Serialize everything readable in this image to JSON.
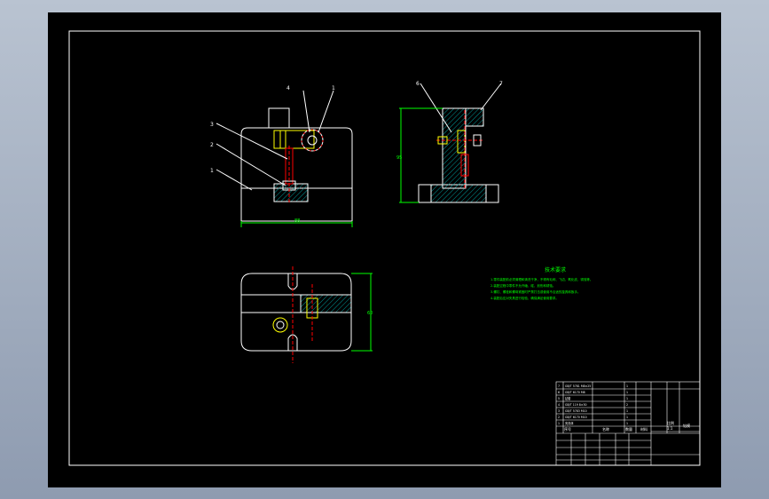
{
  "colors": {
    "background": "#000000",
    "frame": "#ffffff",
    "outline": "#ffffff",
    "dimension": "#00ff00",
    "hatch": "#009999",
    "center_line": "#ff0000",
    "bolt": "#ffff00",
    "notes": "#00ff00",
    "titleblock": "#ffffff"
  },
  "drawing": {
    "front_view": {
      "balloons": [
        "4",
        "1",
        "3",
        "2",
        "1"
      ],
      "dim_width": "88"
    },
    "side_view": {
      "balloons": [
        "6",
        "7"
      ],
      "dim_height": "95"
    },
    "top_view": {
      "dim_height": "60"
    }
  },
  "notes": {
    "title": "技术要求",
    "lines": [
      "1.零件装配前必须清理和清洗干净，不得有毛刺、飞边、氧化皮、锈蚀等。",
      "2.装配过程中零件不允许磕、碰、划伤和锈蚀。",
      "3.螺钉、螺栓和螺母紧固时严禁打击或使用不合适的旋具和扳手。",
      "4.装配后应对夹具进行检验，确保满足使用要求。"
    ]
  },
  "title_block": {
    "header": [
      "序号",
      "名称",
      "数量",
      "材料"
    ],
    "title_cells": [
      "比例",
      "1:1",
      "钻模"
    ],
    "rows": [
      [
        "7",
        "GB/T 5781 M8×25",
        "1"
      ],
      [
        "6",
        "GB/T 6170 M8",
        "1"
      ],
      [
        "5",
        "钻套",
        "1"
      ],
      [
        "4",
        "GB/T 119 8×30",
        "2"
      ],
      [
        "3",
        "GB/T 5783 M10",
        "1"
      ],
      [
        "2",
        "GB/T 6170 M10",
        "1"
      ],
      [
        "1",
        "夹具体",
        "1"
      ]
    ]
  }
}
